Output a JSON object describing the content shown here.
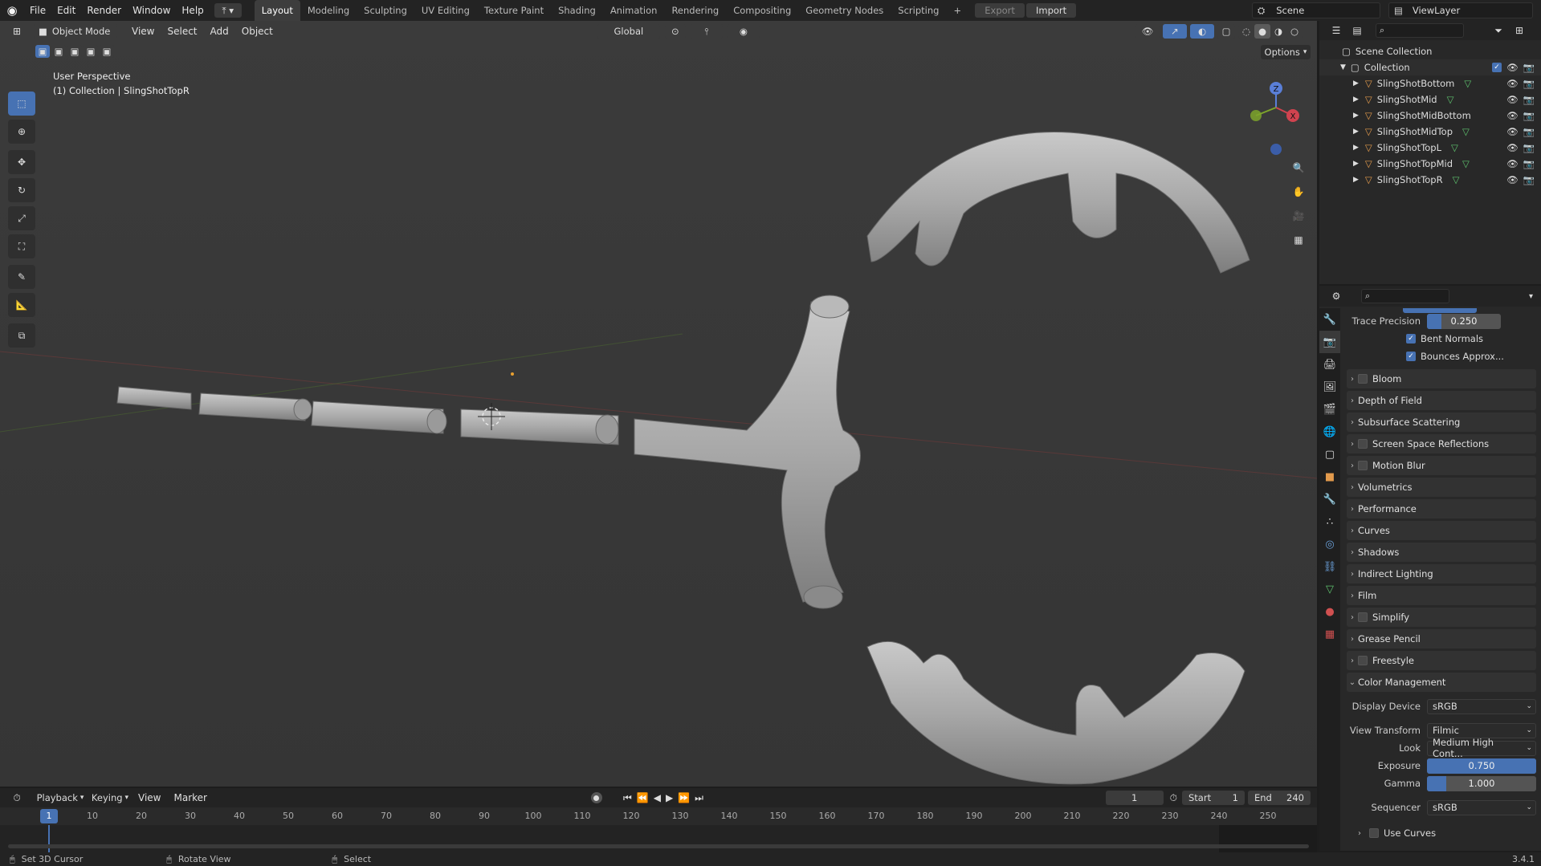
{
  "app": {
    "menus": [
      "File",
      "Edit",
      "Render",
      "Window",
      "Help"
    ],
    "workspaces": [
      "Layout",
      "Modeling",
      "Sculpting",
      "UV Editing",
      "Texture Paint",
      "Shading",
      "Animation",
      "Rendering",
      "Compositing",
      "Geometry Nodes",
      "Scripting"
    ],
    "active_workspace": "Layout",
    "export_label": "Export",
    "import_label": "Import",
    "scene_name": "Scene",
    "view_layer": "ViewLayer"
  },
  "viewport": {
    "mode": "Object Mode",
    "menus": [
      "View",
      "Select",
      "Add",
      "Object"
    ],
    "transform": "Global",
    "options_label": "Options",
    "info_line1": "User Perspective",
    "info_line2": "(1) Collection | SlingShotTopR",
    "gizmo_axes": [
      "Z",
      "X"
    ]
  },
  "outliner": {
    "root": "Scene Collection",
    "collection": "Collection",
    "objects": [
      "SlingShotBottom",
      "SlingShotMid",
      "SlingShotMidBottom",
      "SlingShotMidTop",
      "SlingShotTopL",
      "SlingShotTopMid",
      "SlingShotTopR"
    ]
  },
  "properties": {
    "trace_precision_label": "Trace Precision",
    "trace_precision_value": "0.250",
    "bent_normals": "Bent Normals",
    "bounces_approx": "Bounces Approx...",
    "panels": [
      {
        "label": "Bloom",
        "checkbox": true
      },
      {
        "label": "Depth of Field",
        "checkbox": false
      },
      {
        "label": "Subsurface Scattering",
        "checkbox": false
      },
      {
        "label": "Screen Space Reflections",
        "checkbox": true
      },
      {
        "label": "Motion Blur",
        "checkbox": true
      },
      {
        "label": "Volumetrics",
        "checkbox": false
      },
      {
        "label": "Performance",
        "checkbox": false
      },
      {
        "label": "Curves",
        "checkbox": false
      },
      {
        "label": "Shadows",
        "checkbox": false
      },
      {
        "label": "Indirect Lighting",
        "checkbox": false
      },
      {
        "label": "Film",
        "checkbox": false
      },
      {
        "label": "Simplify",
        "checkbox": true
      },
      {
        "label": "Grease Pencil",
        "checkbox": false
      },
      {
        "label": "Freestyle",
        "checkbox": true
      }
    ],
    "color_management": {
      "title": "Color Management",
      "display_device_label": "Display Device",
      "display_device": "sRGB",
      "view_transform_label": "View Transform",
      "view_transform": "Filmic",
      "look_label": "Look",
      "look": "Medium High Cont...",
      "exposure_label": "Exposure",
      "exposure": "0.750",
      "gamma_label": "Gamma",
      "gamma": "1.000",
      "sequencer_label": "Sequencer",
      "sequencer": "sRGB",
      "use_curves": "Use Curves"
    }
  },
  "timeline": {
    "menus": [
      "Playback",
      "Keying",
      "View",
      "Marker"
    ],
    "current_frame": "1",
    "start_label": "Start",
    "start": "1",
    "end_label": "End",
    "end": "240",
    "ticks": [
      "10",
      "20",
      "30",
      "40",
      "50",
      "60",
      "70",
      "80",
      "90",
      "100",
      "110",
      "120",
      "130",
      "140",
      "150",
      "160",
      "170",
      "180",
      "190",
      "200",
      "210",
      "220",
      "230",
      "240",
      "250"
    ]
  },
  "status": {
    "left": "Set 3D Cursor",
    "mid": "Rotate View",
    "right": "Select",
    "version": "3.4.1"
  },
  "colors": {
    "accent": "#4772b3",
    "viewport_bg": "#393939",
    "panel_bg": "#282828"
  }
}
